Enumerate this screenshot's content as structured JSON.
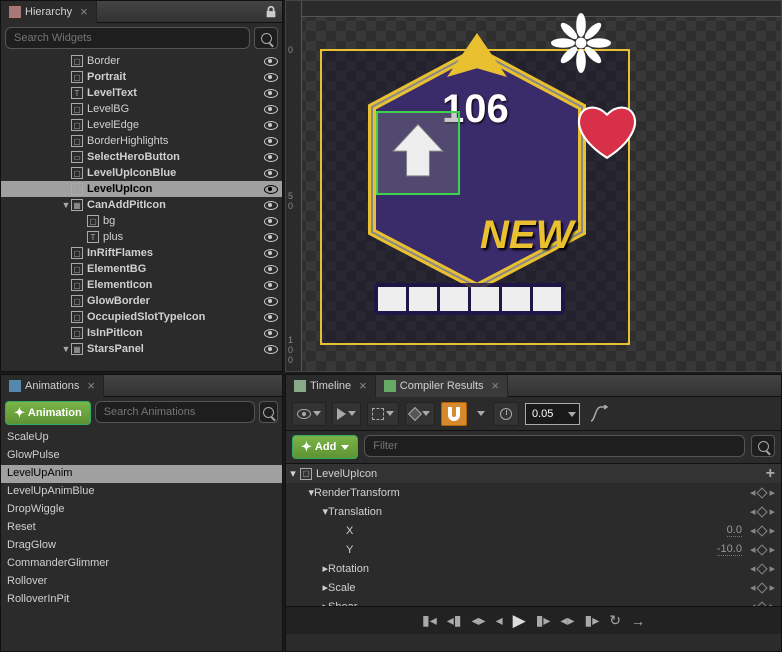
{
  "hierarchy": {
    "title": "Hierarchy",
    "search_placeholder": "Search Widgets",
    "items": [
      {
        "label": "Border",
        "indent": 72,
        "vis": true,
        "bold": false,
        "icon": "img",
        "tw": ""
      },
      {
        "label": "Portrait",
        "indent": 72,
        "vis": true,
        "bold": true,
        "icon": "img",
        "tw": ""
      },
      {
        "label": "LevelText",
        "indent": 72,
        "vis": true,
        "bold": true,
        "icon": "txt",
        "tw": ""
      },
      {
        "label": "LevelBG",
        "indent": 72,
        "vis": true,
        "bold": false,
        "icon": "img",
        "tw": ""
      },
      {
        "label": "LevelEdge",
        "indent": 72,
        "vis": true,
        "bold": false,
        "icon": "img",
        "tw": ""
      },
      {
        "label": "BorderHighlights",
        "indent": 72,
        "vis": true,
        "bold": false,
        "icon": "img",
        "tw": ""
      },
      {
        "label": "SelectHeroButton",
        "indent": 72,
        "vis": true,
        "bold": true,
        "icon": "btn",
        "tw": ""
      },
      {
        "label": "LevelUpIconBlue",
        "indent": 72,
        "vis": true,
        "bold": true,
        "icon": "img",
        "tw": ""
      },
      {
        "label": "LevelUpIcon",
        "indent": 72,
        "vis": true,
        "bold": true,
        "icon": "img",
        "tw": "",
        "selected": true
      },
      {
        "label": "CanAddPitIcon",
        "indent": 72,
        "vis": true,
        "bold": true,
        "icon": "ovr",
        "tw": "▼"
      },
      {
        "label": "bg",
        "indent": 88,
        "vis": true,
        "bold": false,
        "icon": "img",
        "tw": ""
      },
      {
        "label": "plus",
        "indent": 88,
        "vis": true,
        "bold": false,
        "icon": "txt",
        "tw": ""
      },
      {
        "label": "InRiftFlames",
        "indent": 72,
        "vis": true,
        "bold": true,
        "icon": "img",
        "tw": ""
      },
      {
        "label": "ElementBG",
        "indent": 72,
        "vis": true,
        "bold": true,
        "icon": "img",
        "tw": ""
      },
      {
        "label": "ElementIcon",
        "indent": 72,
        "vis": true,
        "bold": true,
        "icon": "img",
        "tw": ""
      },
      {
        "label": "GlowBorder",
        "indent": 72,
        "vis": true,
        "bold": true,
        "icon": "img",
        "tw": ""
      },
      {
        "label": "OccupiedSlotTypeIcon",
        "indent": 72,
        "vis": true,
        "bold": true,
        "icon": "img",
        "tw": ""
      },
      {
        "label": "IsInPitIcon",
        "indent": 72,
        "vis": true,
        "bold": true,
        "icon": "img",
        "tw": ""
      },
      {
        "label": "StarsPanel",
        "indent": 72,
        "vis": true,
        "bold": true,
        "icon": "ovr",
        "tw": "▼"
      }
    ]
  },
  "viewport": {
    "level_text": "106",
    "new_text": "NEW"
  },
  "animations": {
    "title": "Animations",
    "add_label": "Animation",
    "search_placeholder": "Search Animations",
    "items": [
      "ScaleUp",
      "GlowPulse",
      "LevelUpAnim",
      "LevelUpAnimBlue",
      "DropWiggle",
      "Reset",
      "DragGlow",
      "CommanderGlimmer",
      "Rollover",
      "RolloverInPit"
    ],
    "selected": "LevelUpAnim"
  },
  "timeline": {
    "tabs": [
      "Timeline",
      "Compiler Results"
    ],
    "time_value": "0.05",
    "add_label": "Add",
    "filter_placeholder": "Filter",
    "track_root": "LevelUpIcon",
    "props": {
      "render_transform": "RenderTransform",
      "translation": "Translation",
      "x_label": "X",
      "x_value": "0.0",
      "y_label": "Y",
      "y_value": "-10.0",
      "rotation": "Rotation",
      "scale": "Scale",
      "shear": "Shear"
    }
  }
}
